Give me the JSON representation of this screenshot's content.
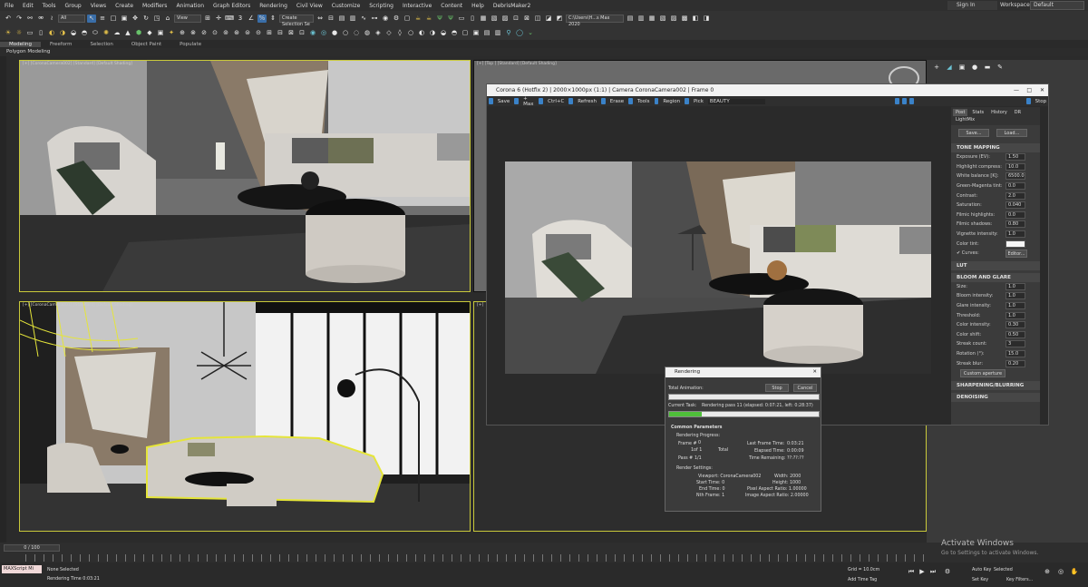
{
  "menu": [
    "File",
    "Edit",
    "Tools",
    "Group",
    "Views",
    "Create",
    "Modifiers",
    "Animation",
    "Graph Editors",
    "Rendering",
    "Civil View",
    "Customize",
    "Scripting",
    "Interactive",
    "Content",
    "Help",
    "DebrisMaker2"
  ],
  "signin": "Sign In",
  "workspaces_label": "Workspaces:",
  "workspace_value": "Default",
  "toolbar": {
    "filter": "All",
    "view": "View",
    "selection_set": "Create Selection Se",
    "path": "C:\\Users\\H...s Max 2020"
  },
  "ribbon_tabs": [
    "Modeling",
    "Freeform",
    "Selection",
    "Object Paint",
    "Populate"
  ],
  "ribbon_sub": "Polygon Modeling",
  "viewports": {
    "top_left": "[+] [CoronaCamera002] [Standard] [Default Shading]",
    "top_right": "[+] [Top ] [Standard] [Default Shading]",
    "bottom_left": "[+] [CoronaCamera001] [Standard] [Default Shading]",
    "bottom_right": "[+]"
  },
  "vfb": {
    "title": "Corona 6 (Hotfix 2) | 2000×1000px (1:1) | Camera CoronaCamera002 | Frame 0",
    "toolbar": [
      "Save",
      "+ Max",
      "Ctrl+C",
      "Refresh",
      "Erase",
      "Tools",
      "Region",
      "Pick"
    ],
    "channel": "BEAUTY",
    "stop": "Stop",
    "side_tabs": [
      "Post",
      "Stats",
      "History",
      "DR",
      "LightMix"
    ],
    "save_btn": "Save...",
    "load_btn": "Load...",
    "tone_mapping": "TONE MAPPING",
    "tm_rows": [
      {
        "label": "Exposure (EV):",
        "value": "1.50"
      },
      {
        "label": "Highlight compress:",
        "value": "10.0"
      },
      {
        "label": "White balance [K]:",
        "value": "6500.0"
      },
      {
        "label": "Green-Magenta tint:",
        "value": "0.0"
      },
      {
        "label": "Contrast:",
        "value": "2.0"
      },
      {
        "label": "Saturation:",
        "value": "0.040"
      },
      {
        "label": "Filmic highlights:",
        "value": "0.0"
      },
      {
        "label": "Filmic shadows:",
        "value": "0.80"
      },
      {
        "label": "Vignette intensity:",
        "value": "1.0"
      },
      {
        "label": "Color tint:",
        "value": ""
      }
    ],
    "curves": "✔ Curves:",
    "editor": "Editor...",
    "lut": "LUT",
    "bloom": "BLOOM AND GLARE",
    "bg_rows": [
      {
        "label": "Size:",
        "value": "1.0"
      },
      {
        "label": "Bloom intensity:",
        "value": "1.0"
      },
      {
        "label": "Glare intensity:",
        "value": "1.0"
      },
      {
        "label": "Threshold:",
        "value": "1.0"
      },
      {
        "label": "Color intensity:",
        "value": "0.30"
      },
      {
        "label": "Color shift:",
        "value": "0.50"
      },
      {
        "label": "Streak count:",
        "value": "3"
      },
      {
        "label": "Rotation (°):",
        "value": "15.0"
      },
      {
        "label": "Streak blur:",
        "value": "0.20"
      }
    ],
    "custom_aperture": "Custom aperture",
    "sharpening": "SHARPENING/BLURRING",
    "denoising": "DENOISING"
  },
  "rendering": {
    "title": "Rendering",
    "stop": "Stop",
    "cancel": "Cancel",
    "total_animation": "Total Animation:",
    "current_task": "Current Task:",
    "task_text": "Rendering pass 11 (elapsed: 0:07:21, left: 0:28:37)",
    "progress": 0.22,
    "common": "Common Parameters",
    "render_progress": "Rendering Progress:",
    "frame_label": "Frame #",
    "frame_val": "0",
    "of_label": "1of 1",
    "total": "Total",
    "pass_label": "Pass #",
    "pass_val": "1/1",
    "last_frame": "Last Frame Time:",
    "last_frame_val": "0:03:21",
    "elapsed": "Elapsed Time:",
    "elapsed_val": "0:00:09",
    "remaining": "Time Remaining:",
    "remaining_val": "??:??:??",
    "render_settings": "Render Settings:",
    "viewport": "Viewport: CoronaCamera002",
    "width": "Width: 2000",
    "start_time": "Start Time: 0",
    "height": "Height: 1000",
    "end_time": "End Time: 0",
    "pixel_aspect": "Pixel Aspect Ratio: 1.00000",
    "nth_frame": "Nth Frame: 1",
    "image_aspect": "Image Aspect Ratio: 2.00000"
  },
  "timeline": {
    "frame": "0 / 100"
  },
  "status": {
    "maxscript": "MAXScript Mi",
    "none_selected": "None Selected",
    "render_time": "Rendering Time  0:03:21",
    "grid": "Grid = 10.0cm",
    "add_time_tag": "Add Time Tag",
    "auto_key": "Auto Key",
    "selected": "Selected",
    "set_key": "Set Key",
    "key_filters": "Key Filters..."
  },
  "activate": "Activate Windows",
  "activate_sub": "Go to Settings to activate Windows.",
  "colors": {
    "accent": "#3a82c8",
    "active_border": "#c9c93a",
    "progress": "#4fbf3a"
  }
}
